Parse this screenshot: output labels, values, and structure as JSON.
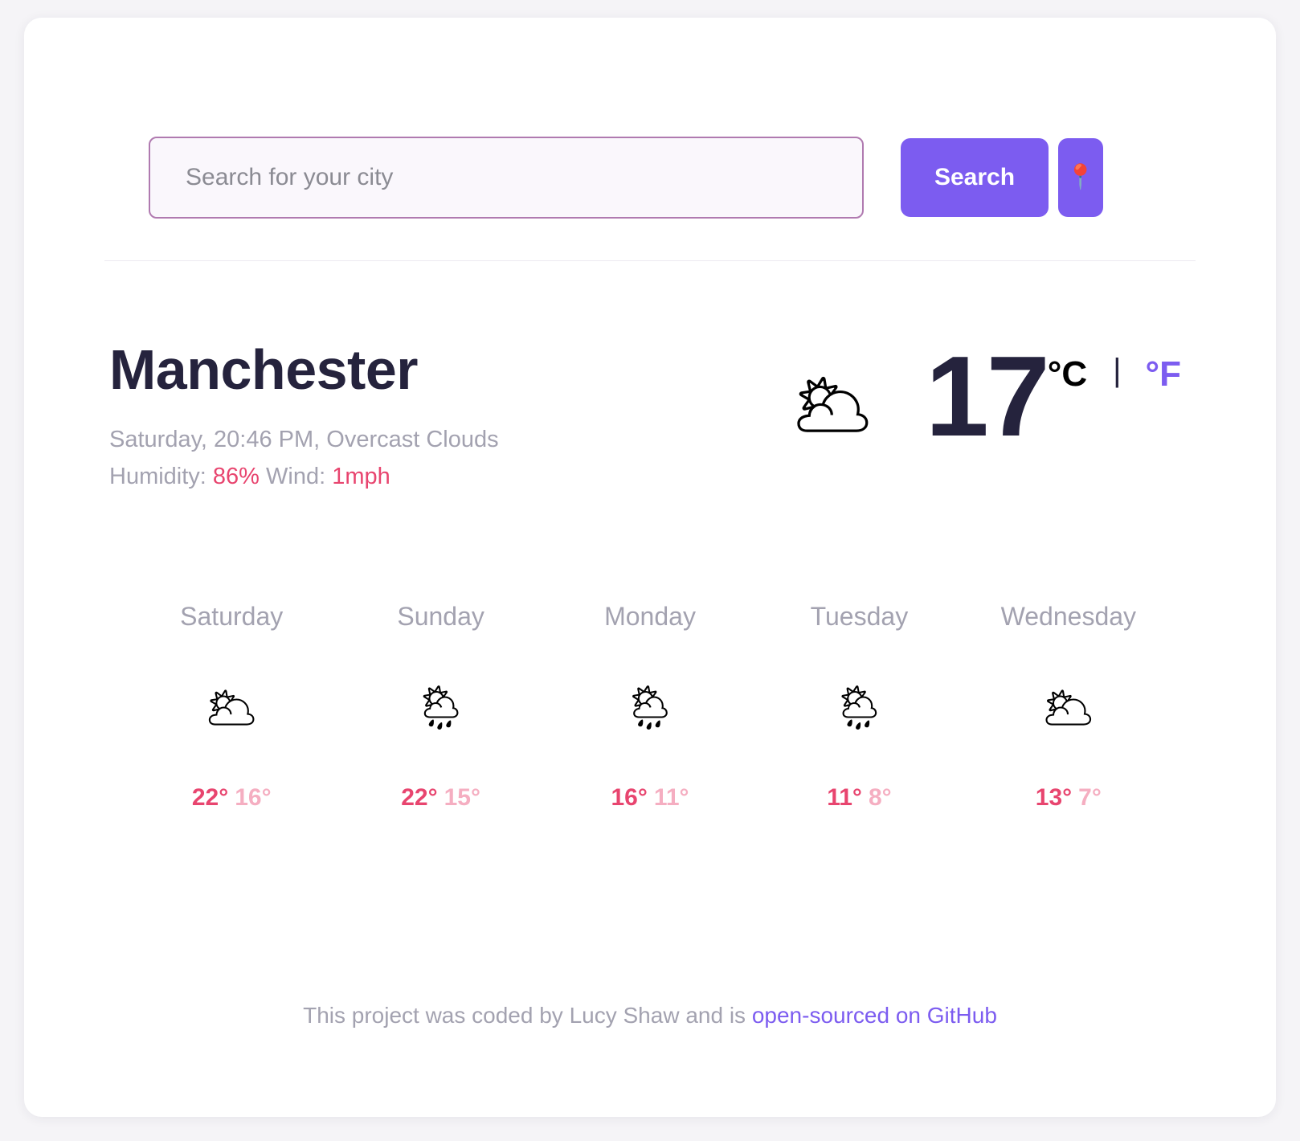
{
  "search": {
    "placeholder": "Search for your city",
    "value": "",
    "button_label": "Search",
    "location_icon": "round-pushpin-icon",
    "location_glyph": "📍"
  },
  "current": {
    "city": "Manchester",
    "meta_line": "Saturday, 20:46 PM, Overcast Clouds",
    "humidity_label": "Humidity: ",
    "humidity_value": "86%",
    "wind_label": " Wind: ",
    "wind_value": "1mph",
    "icon_name": "overcast-clouds-icon",
    "icon_glyph": "🌥",
    "temperature": "17",
    "unit_celsius": "°C",
    "unit_separator": "|",
    "unit_fahrenheit": "°F",
    "active_unit": "celsius"
  },
  "forecast": {
    "days": [
      {
        "day": "Saturday",
        "icon_name": "overcast-clouds-icon",
        "icon_glyph": "🌥",
        "temp_max": "22°",
        "temp_min": "16°"
      },
      {
        "day": "Sunday",
        "icon_name": "sun-behind-rain-cloud-icon",
        "icon_glyph": "🌦",
        "temp_max": "22°",
        "temp_min": "15°"
      },
      {
        "day": "Monday",
        "icon_name": "sun-behind-rain-cloud-icon",
        "icon_glyph": "🌦",
        "temp_max": "16°",
        "temp_min": "11°"
      },
      {
        "day": "Tuesday",
        "icon_name": "sun-behind-rain-cloud-icon",
        "icon_glyph": "🌦",
        "temp_max": "11°",
        "temp_min": "8°"
      },
      {
        "day": "Wednesday",
        "icon_name": "overcast-clouds-icon",
        "icon_glyph": "🌥",
        "temp_max": "13°",
        "temp_min": "7°"
      }
    ]
  },
  "footer": {
    "text": "This project was coded by Lucy Shaw and is ",
    "link_text": "open-sourced on GitHub"
  },
  "colors": {
    "accent_purple": "#7c5cf0",
    "hot_pink": "#e8456f",
    "soft_pink": "#f5aec1",
    "muted_grey": "#a3a2b0",
    "dark_navy": "#25233d",
    "input_border": "#b07ab0",
    "page_bg": "#f5f4f7"
  }
}
